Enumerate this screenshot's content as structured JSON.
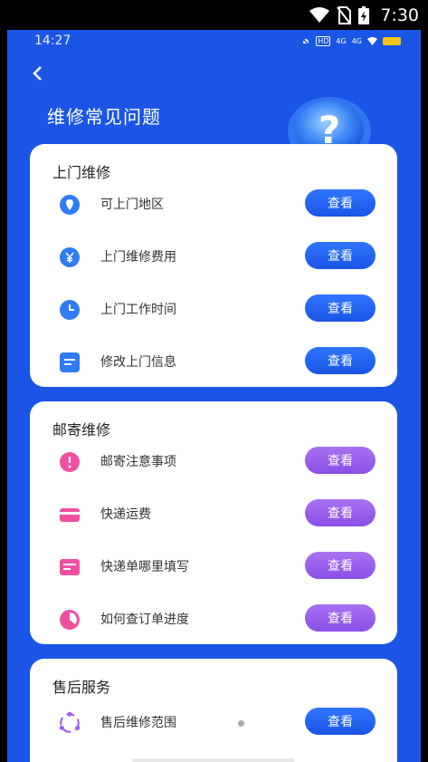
{
  "system_bar": {
    "time": "7:30"
  },
  "inner_status": {
    "time": "14:27",
    "badge1": "HD",
    "sig1": "4G",
    "sig2": "4G"
  },
  "page": {
    "title": "维修常见问题",
    "help_symbol": "?"
  },
  "colors": {
    "primary": "#1a55e6",
    "purple": "#9b5ef0",
    "yellow": "#f7c41c"
  },
  "sections": [
    {
      "title": "上门维修",
      "items": [
        {
          "label": "可上门地区",
          "icon": "location-pin-icon",
          "button": "查看"
        },
        {
          "label": "上门维修费用",
          "icon": "yen-coin-icon",
          "button": "查看"
        },
        {
          "label": "上门工作时间",
          "icon": "clock-icon",
          "button": "查看"
        },
        {
          "label": "修改上门信息",
          "icon": "document-edit-icon",
          "button": "查看"
        }
      ]
    },
    {
      "title": "邮寄维修",
      "items": [
        {
          "label": "邮寄注意事项",
          "icon": "exclamation-icon",
          "button": "查看"
        },
        {
          "label": "快递运费",
          "icon": "credit-card-icon",
          "button": "查看"
        },
        {
          "label": "快递单哪里填写",
          "icon": "waybill-icon",
          "button": "查看"
        },
        {
          "label": "如何查订单进度",
          "icon": "progress-pie-icon",
          "button": "查看"
        }
      ]
    },
    {
      "title": "售后服务",
      "items": [
        {
          "label": "售后维修范围",
          "icon": "scope-ring-icon",
          "button": "查看"
        }
      ]
    }
  ]
}
